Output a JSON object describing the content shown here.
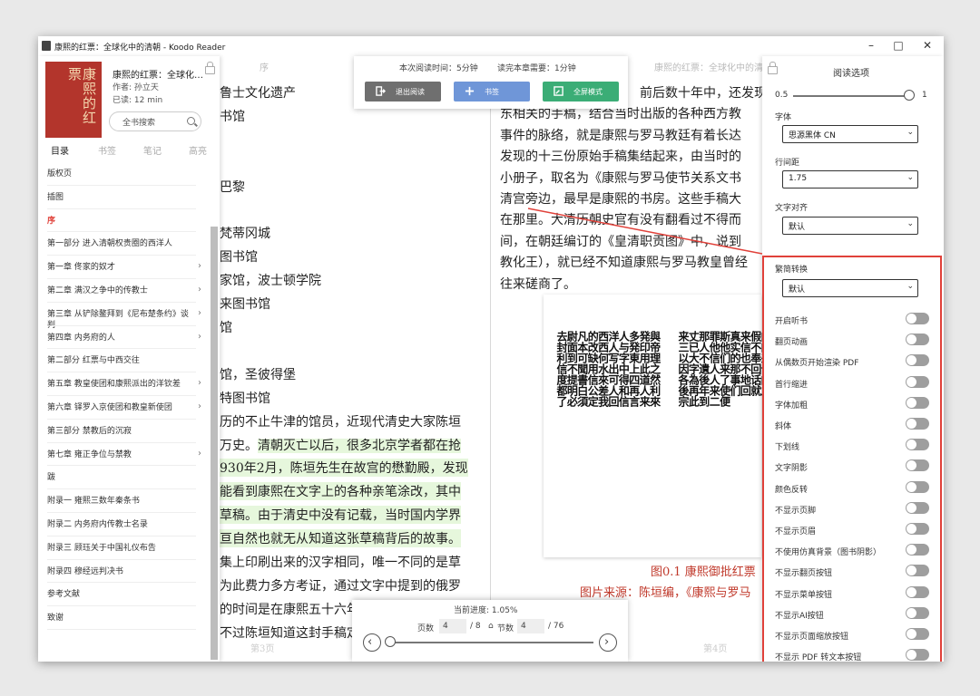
{
  "window": {
    "title": "康熙的红票：全球化中的清朝 - Koodo Reader"
  },
  "book": {
    "title": "康熙的红票：全球化…",
    "author": "作者: 孙立天",
    "read_time": "已读: 12 min",
    "cover_text": "康熙的红票",
    "search_label": "全书搜索"
  },
  "tabs": [
    "目录",
    "书签",
    "笔记",
    "高亮"
  ],
  "toc": [
    {
      "label": "版权页",
      "chevron": false
    },
    {
      "label": "插图",
      "chevron": false
    },
    {
      "label": "序",
      "chevron": false,
      "active": true
    },
    {
      "label": "第一部分 进入清朝权贵圈的西洋人",
      "chevron": false
    },
    {
      "label": "第一章 佟家的奴才",
      "chevron": true
    },
    {
      "label": "第二章 满汉之争中的传教士",
      "chevron": true
    },
    {
      "label": "第三章 从铲除鳌拜到《尼布楚条约》谈判",
      "chevron": true
    },
    {
      "label": "第四章 内务府的人",
      "chevron": true
    },
    {
      "label": "第二部分 红票与中西交往",
      "chevron": false
    },
    {
      "label": "第五章 教皇使团和康熙派出的洋钦差",
      "chevron": true
    },
    {
      "label": "第六章 铎罗入京使团和教皇新使团",
      "chevron": true
    },
    {
      "label": "第三部分 禁教后的沉寂",
      "chevron": false
    },
    {
      "label": "第七章 雍正争位与禁教",
      "chevron": true
    },
    {
      "label": "跋",
      "chevron": false
    },
    {
      "label": "附录一 雍熙三数年秦条书",
      "chevron": false
    },
    {
      "label": "附录二 内务府内传教士名录",
      "chevron": false
    },
    {
      "label": "附录三 顾珏关于中国礼仪布告",
      "chevron": false
    },
    {
      "label": "附录四 穆经远判决书",
      "chevron": false
    },
    {
      "label": "参考文献",
      "chevron": false
    },
    {
      "label": "致谢",
      "chevron": false
    }
  ],
  "top_overlay": {
    "read_time": "本次阅读时间：5分钟",
    "remaining": "读完本章需要：1分钟",
    "exit_label": "退出阅读",
    "bookmark_label": "书签",
    "fullscreen_label": "全屏模式",
    "colors": {
      "exit": "#6f6f6f",
      "bookmark": "#6f96d8",
      "fullscreen": "#3bad76"
    }
  },
  "left_page": {
    "header": "序",
    "footer": "第3页",
    "lines": [
      {
        "text": "鲁士文化遗产",
        "hl": false
      },
      {
        "text": "书馆",
        "hl": false
      },
      {
        "text": "",
        "hl": false
      },
      {
        "text": "",
        "hl": false
      },
      {
        "text": "巴黎",
        "hl": false
      },
      {
        "text": "",
        "hl": false
      },
      {
        "text": "  梵蒂冈城",
        "hl": false
      },
      {
        "text": "图书馆",
        "hl": false
      },
      {
        "text": "家馆，波士顿学院",
        "hl": false
      },
      {
        "text": "来图书馆",
        "hl": false
      },
      {
        "text": "馆",
        "hl": false
      },
      {
        "text": "",
        "hl": false
      },
      {
        "text": "馆，圣彼得堡",
        "hl": false
      },
      {
        "text": "特图书馆",
        "hl": false
      },
      {
        "text": "历的不止牛津的馆员，近现代清史大家陈垣",
        "hl": false
      },
      {
        "text": "万史。",
        "hl": false,
        "tail": "清朝灭亡以后，很多北京学者都在抢"
      },
      {
        "text": "930年2月，陈垣先生在故宫的懋勤殿，发现",
        "hl": true
      },
      {
        "text": "能看到康熙在文字上的各种亲笔涂改，其中",
        "hl": true
      },
      {
        "text": "草稿。由于清史中没有记载，当时国内学界",
        "hl": true
      },
      {
        "text": "亘自然也就无从知道这张草稿背后的故事。",
        "hl": true
      },
      {
        "text": "集上印刷出来的汉字相同，唯一不同的是草",
        "hl": false
      },
      {
        "text": "为此费力多方考证，通过文字中提到的俄罗",
        "hl": false
      },
      {
        "text": "的时间是在康熙五十六年，与实际时间康熙",
        "hl": false
      },
      {
        "text": "不过陈垣知道这封手稿定",
        "hl": false
      }
    ]
  },
  "right_page": {
    "header": "康熙的红票：全球化中的清",
    "footer": "第4页",
    "lines": [
      "前后数十年中，还发现了",
      "东相关的手稿，结合当时出版的各种西方教",
      "事件的脉络，就是康熙与罗马教廷有着长达",
      "发现的十三份原始手稿集结起来，由当时的",
      "小册子，取名为《康熙与罗马使节关系文书",
      "清宫旁边，最早是康熙的书房。这些手稿大",
      "在那里。大清历朝史官有没有翻看过不得而",
      "间，在朝廷编订的《皇清职贡图》中，说到",
      "教化王），就已经不知道康熙与罗马教皇曾经",
      "往来磋商了。"
    ],
    "figure_columns": [
      "去封利信度都了",
      "尉面到不提明必",
      "凡本可聞書白須",
      "的改缺用信公定",
      "西西何水來差我",
      "洋人写出可人回",
      "人与字中得和信",
      "多発東上四再言",
      "発印用此道人来",
      "與帝理之然利來",
      "来三以因各後宗",
      "丈已大字為再此",
      "那人不遺後年到",
      "罪他信人人来二",
      "斯他们来了使便",
      "真实的那事们",
      "来信也不地回",
      "假不奉回话就",
      "的的来今的之",
      "此若会因以前"
    ],
    "caption1": "图0.1 康熙御批红票",
    "caption2": "图片来源：陈垣编，《康熙与罗马"
  },
  "bottom_overlay": {
    "progress": "当前进度: 1.05%",
    "page_label": "页数",
    "page_value": "4",
    "page_total": "/ 8",
    "section_label": "节数",
    "section_value": "4",
    "section_total": "/ 76",
    "progress_fraction": 0.0105
  },
  "settings": {
    "title": "阅读选项",
    "opacity_min": "0.5",
    "opacity_max": "1",
    "opacity_value": 1,
    "font_label": "字体",
    "font_value": "思源黑体 CN",
    "line_height_label": "行间距",
    "line_height_value": "1.75",
    "align_label": "文字对齐",
    "align_value": "默认",
    "convert_label": "繁简转换",
    "convert_value": "默认",
    "toggles": [
      "开启听书",
      "翻页动画",
      "从偶数页开始渲染 PDF",
      "首行缩进",
      "字体加粗",
      "斜体",
      "下划线",
      "文字阴影",
      "颜色反转",
      "不显示页脚",
      "不显示页眉",
      "不使用仿真背景（图书阴影）",
      "不显示翻页按钮",
      "不显示菜单按钮",
      "不显示AI按钮",
      "不显示页面缩放按钮",
      "不显示 PDF 转文本按钮"
    ],
    "highlight_color": "#e0413a"
  }
}
